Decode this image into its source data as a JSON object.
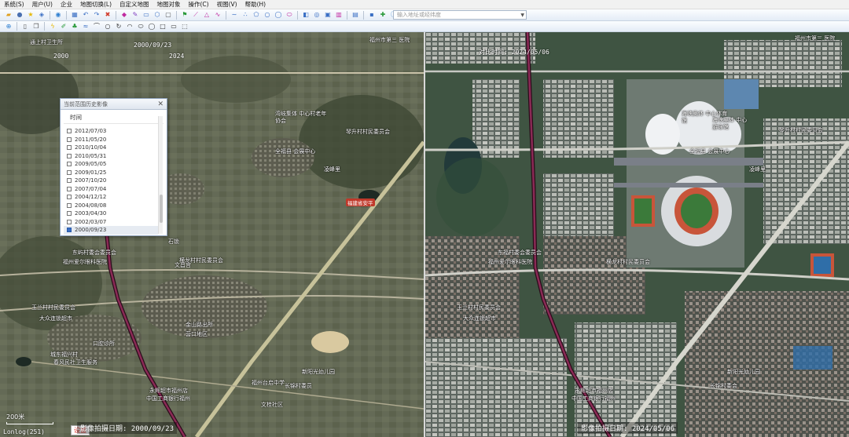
{
  "menu": [
    "系统(S)",
    "用户(U)",
    "企业",
    "地图切换(L)",
    "自定义地图",
    "地图对象",
    "操作(C)",
    "视图(V)",
    "帮助(H)"
  ],
  "search": {
    "placeholder": "输入地址或经纬度"
  },
  "left_map": {
    "top_dates": [
      "2000",
      "2000/09/23",
      "2024"
    ],
    "pois": [
      {
        "text": "通上村卫生所"
      },
      {
        "text": "湾岐集体 中心村老年协会"
      },
      {
        "text": "琴升村村民委员会"
      },
      {
        "text": "全福县 会展中心"
      },
      {
        "text": "凌峰里"
      },
      {
        "text": "福建省安平"
      },
      {
        "text": "东屿村委会委员会"
      },
      {
        "text": "福州爱尔眼科医院"
      },
      {
        "text": "横龙村村民委员会"
      },
      {
        "text": "文昌宫"
      },
      {
        "text": "石锁"
      },
      {
        "text": "玉兰村村民委员会"
      },
      {
        "text": "大众连锁超市"
      },
      {
        "text": "城东福兴村"
      },
      {
        "text": "口腔诊所"
      },
      {
        "text": "春风民社卫生服务"
      },
      {
        "text": "金山路出所"
      },
      {
        "text": "营口地区"
      },
      {
        "text": "永辉超市福州店"
      },
      {
        "text": "中国工商银行福州"
      },
      {
        "text": "福州台启中学"
      },
      {
        "text": "长锦村委员"
      },
      {
        "text": "新阳光幼儿园"
      },
      {
        "text": "文桂社区"
      },
      {
        "text": "福州市第三 医院"
      }
    ],
    "scale": "200米",
    "coordinate": "Lonlog(251)",
    "settings_label": "设置",
    "bottom_label": "影像拍摄日期: 2000/09/23"
  },
  "right_map": {
    "top_label": "对比时间: 2024/05/06",
    "pois": [
      {
        "text": "海峡奥体 中心体育馆"
      },
      {
        "text": "海峡奥体 中心游泳馆"
      },
      {
        "text": "全福县 会展中心"
      },
      {
        "text": "琴升村村民委员会"
      },
      {
        "text": "凌峰里"
      },
      {
        "text": "福州市第三 医院"
      },
      {
        "text": "东福村委会委员会"
      },
      {
        "text": "福州爱尔眼科医院"
      },
      {
        "text": "横龙村村民委员会"
      },
      {
        "text": "玉兰村村民委员会"
      },
      {
        "text": "大众连锁超市"
      },
      {
        "text": "永辉超市福州店"
      },
      {
        "text": "中国工商银行福州"
      },
      {
        "text": "长锦村委会"
      },
      {
        "text": "新阳光幼儿园"
      }
    ],
    "bottom_label": "影像拍摄日期: 2024/05/06"
  },
  "history_panel": {
    "title": "当前范围历史影像",
    "column_header": "时间",
    "dates": [
      "2012/07/03",
      "2011/05/20",
      "2010/10/04",
      "2010/05/31",
      "2009/05/05",
      "2009/01/25",
      "2007/10/20",
      "2007/07/04",
      "2004/12/12",
      "2004/08/08",
      "2003/04/30",
      "2002/03/07",
      "2000/09/23"
    ],
    "selected_index": 12
  },
  "colors": {
    "accent": "#3a6fc4",
    "road_highlight": "#7a1b3a",
    "settings_text": "#e0322b"
  }
}
